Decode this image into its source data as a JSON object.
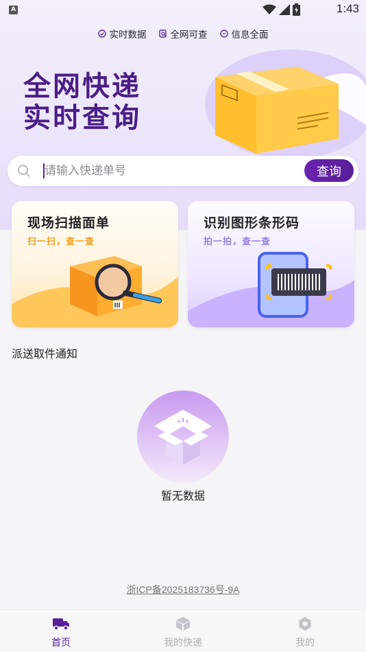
{
  "status_bar": {
    "app_icon_letter": "A",
    "time": "1:43"
  },
  "features": [
    {
      "icon": "clock-icon",
      "label": "实时数据"
    },
    {
      "icon": "search-doc-icon",
      "label": "全网可查"
    },
    {
      "icon": "chat-icon",
      "label": "信息全面"
    }
  ],
  "hero": {
    "line1": "全网快递",
    "line2": "实时查询"
  },
  "search": {
    "placeholder": "请输入快递单号",
    "value": "",
    "button_label": "查询"
  },
  "cards": [
    {
      "title": "现场扫描面单",
      "subtitle": "扫一扫，查一查"
    },
    {
      "title": "识别图形条形码",
      "subtitle": "拍一拍，查一查"
    }
  ],
  "section": {
    "title": "派送取件通知"
  },
  "empty_state": {
    "text": "暂无数据"
  },
  "footer": {
    "icp": "浙ICP备2025183736号-9A"
  },
  "bottom_nav": [
    {
      "label": "首页",
      "icon": "truck-icon",
      "active": true
    },
    {
      "label": "我的快递",
      "icon": "box-icon",
      "active": false
    },
    {
      "label": "我的",
      "icon": "gear-icon",
      "active": false
    }
  ],
  "colors": {
    "brand": "#571e98",
    "accent_orange": "#f0a21e",
    "accent_lavender": "#9b83dd"
  }
}
